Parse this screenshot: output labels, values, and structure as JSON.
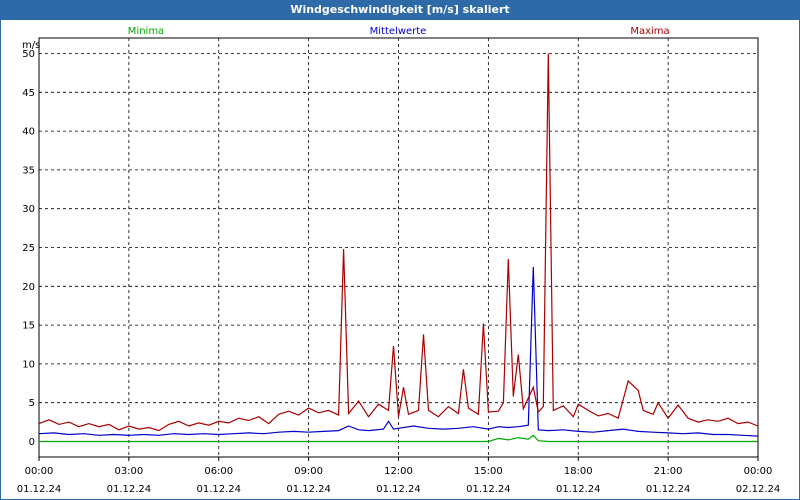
{
  "window": {
    "title": "Windgeschwindigkeit [m/s] skaliert"
  },
  "chart_data": {
    "type": "line",
    "title": "Windgeschwindigkeit [m/s] skaliert",
    "ylabel": "m/s",
    "xlabel": "",
    "ylim": [
      -2,
      52
    ],
    "y_ticks": [
      0,
      5,
      10,
      15,
      20,
      25,
      30,
      35,
      40,
      45,
      50
    ],
    "x_ticks": [
      {
        "time": "00:00",
        "date": "01.12.24"
      },
      {
        "time": "03:00",
        "date": "01.12.24"
      },
      {
        "time": "06:00",
        "date": "01.12.24"
      },
      {
        "time": "09:00",
        "date": "01.12.24"
      },
      {
        "time": "12:00",
        "date": "01.12.24"
      },
      {
        "time": "15:00",
        "date": "01.12.24"
      },
      {
        "time": "18:00",
        "date": "01.12.24"
      },
      {
        "time": "21:00",
        "date": "01.12.24"
      },
      {
        "time": "00:00",
        "date": "02.12.24"
      }
    ],
    "grid": true,
    "legend_position": "top",
    "series": [
      {
        "name": "Minima",
        "color": "#00aa00",
        "points": [
          [
            "00:00",
            0
          ],
          [
            "15:00",
            0
          ],
          [
            "15:20",
            0.4
          ],
          [
            "15:40",
            0.2
          ],
          [
            "16:00",
            0.5
          ],
          [
            "16:20",
            0.3
          ],
          [
            "16:30",
            0.8
          ],
          [
            "16:40",
            0.1
          ],
          [
            "17:00",
            0
          ],
          [
            "24:00",
            0
          ]
        ]
      },
      {
        "name": "Mittelwerte",
        "color": "#0000cc",
        "points": [
          [
            "00:00",
            1.0
          ],
          [
            "00:30",
            1.1
          ],
          [
            "01:00",
            0.9
          ],
          [
            "01:30",
            1.0
          ],
          [
            "02:00",
            0.8
          ],
          [
            "02:30",
            0.9
          ],
          [
            "03:00",
            0.8
          ],
          [
            "03:30",
            0.9
          ],
          [
            "04:00",
            0.8
          ],
          [
            "04:30",
            1.0
          ],
          [
            "05:00",
            0.9
          ],
          [
            "05:30",
            1.0
          ],
          [
            "06:00",
            0.9
          ],
          [
            "06:30",
            1.0
          ],
          [
            "07:00",
            1.1
          ],
          [
            "07:30",
            1.0
          ],
          [
            "08:00",
            1.2
          ],
          [
            "08:30",
            1.3
          ],
          [
            "09:00",
            1.2
          ],
          [
            "09:30",
            1.3
          ],
          [
            "10:00",
            1.4
          ],
          [
            "10:20",
            2.0
          ],
          [
            "10:40",
            1.5
          ],
          [
            "11:00",
            1.4
          ],
          [
            "11:30",
            1.6
          ],
          [
            "11:40",
            2.6
          ],
          [
            "11:50",
            1.6
          ],
          [
            "12:00",
            1.7
          ],
          [
            "12:30",
            2.0
          ],
          [
            "13:00",
            1.7
          ],
          [
            "13:30",
            1.6
          ],
          [
            "14:00",
            1.7
          ],
          [
            "14:30",
            1.9
          ],
          [
            "15:00",
            1.6
          ],
          [
            "15:20",
            1.9
          ],
          [
            "15:40",
            1.8
          ],
          [
            "16:00",
            1.9
          ],
          [
            "16:20",
            2.1
          ],
          [
            "16:30",
            22.5
          ],
          [
            "16:40",
            1.5
          ],
          [
            "17:00",
            1.4
          ],
          [
            "17:30",
            1.5
          ],
          [
            "18:00",
            1.3
          ],
          [
            "18:30",
            1.2
          ],
          [
            "19:00",
            1.4
          ],
          [
            "19:30",
            1.6
          ],
          [
            "20:00",
            1.3
          ],
          [
            "20:30",
            1.2
          ],
          [
            "21:00",
            1.1
          ],
          [
            "21:30",
            1.0
          ],
          [
            "22:00",
            1.1
          ],
          [
            "22:30",
            0.9
          ],
          [
            "23:00",
            0.9
          ],
          [
            "23:30",
            0.8
          ],
          [
            "24:00",
            0.7
          ]
        ]
      },
      {
        "name": "Maxima",
        "color": "#aa0000",
        "points": [
          [
            "00:00",
            2.3
          ],
          [
            "00:20",
            2.8
          ],
          [
            "00:40",
            2.2
          ],
          [
            "01:00",
            2.5
          ],
          [
            "01:20",
            1.9
          ],
          [
            "01:40",
            2.3
          ],
          [
            "02:00",
            1.9
          ],
          [
            "02:20",
            2.2
          ],
          [
            "02:40",
            1.5
          ],
          [
            "03:00",
            2.0
          ],
          [
            "03:20",
            1.6
          ],
          [
            "03:40",
            1.8
          ],
          [
            "04:00",
            1.4
          ],
          [
            "04:20",
            2.2
          ],
          [
            "04:40",
            2.6
          ],
          [
            "05:00",
            2.0
          ],
          [
            "05:20",
            2.4
          ],
          [
            "05:40",
            2.1
          ],
          [
            "06:00",
            2.6
          ],
          [
            "06:20",
            2.4
          ],
          [
            "06:40",
            3.0
          ],
          [
            "07:00",
            2.7
          ],
          [
            "07:20",
            3.2
          ],
          [
            "07:40",
            2.3
          ],
          [
            "08:00",
            3.5
          ],
          [
            "08:20",
            3.9
          ],
          [
            "08:40",
            3.4
          ],
          [
            "09:00",
            4.3
          ],
          [
            "09:20",
            3.7
          ],
          [
            "09:40",
            4.0
          ],
          [
            "10:00",
            3.4
          ],
          [
            "10:10",
            24.8
          ],
          [
            "10:20",
            3.6
          ],
          [
            "10:40",
            5.2
          ],
          [
            "11:00",
            3.2
          ],
          [
            "11:20",
            4.8
          ],
          [
            "11:40",
            4.0
          ],
          [
            "11:50",
            12.3
          ],
          [
            "12:00",
            3.2
          ],
          [
            "12:10",
            7.0
          ],
          [
            "12:20",
            3.5
          ],
          [
            "12:40",
            4.0
          ],
          [
            "12:50",
            13.8
          ],
          [
            "13:00",
            4.0
          ],
          [
            "13:20",
            3.2
          ],
          [
            "13:40",
            4.5
          ],
          [
            "14:00",
            3.6
          ],
          [
            "14:10",
            9.3
          ],
          [
            "14:20",
            4.3
          ],
          [
            "14:40",
            3.5
          ],
          [
            "14:50",
            15.2
          ],
          [
            "15:00",
            3.8
          ],
          [
            "15:20",
            3.9
          ],
          [
            "15:30",
            5.0
          ],
          [
            "15:40",
            23.5
          ],
          [
            "15:50",
            5.8
          ],
          [
            "16:00",
            11.2
          ],
          [
            "16:10",
            4.2
          ],
          [
            "16:30",
            7.0
          ],
          [
            "16:40",
            3.8
          ],
          [
            "16:50",
            4.5
          ],
          [
            "17:00",
            50.0
          ],
          [
            "17:10",
            4.0
          ],
          [
            "17:30",
            4.6
          ],
          [
            "17:50",
            3.2
          ],
          [
            "18:00",
            4.8
          ],
          [
            "18:20",
            4.0
          ],
          [
            "18:40",
            3.3
          ],
          [
            "19:00",
            3.6
          ],
          [
            "19:20",
            3.0
          ],
          [
            "19:40",
            7.8
          ],
          [
            "20:00",
            6.6
          ],
          [
            "20:10",
            4.0
          ],
          [
            "20:30",
            3.5
          ],
          [
            "20:40",
            5.0
          ],
          [
            "21:00",
            3.0
          ],
          [
            "21:20",
            4.7
          ],
          [
            "21:40",
            3.0
          ],
          [
            "22:00",
            2.5
          ],
          [
            "22:20",
            2.8
          ],
          [
            "22:40",
            2.6
          ],
          [
            "23:00",
            3.0
          ],
          [
            "23:20",
            2.3
          ],
          [
            "23:40",
            2.5
          ],
          [
            "24:00",
            2.0
          ]
        ]
      }
    ]
  }
}
